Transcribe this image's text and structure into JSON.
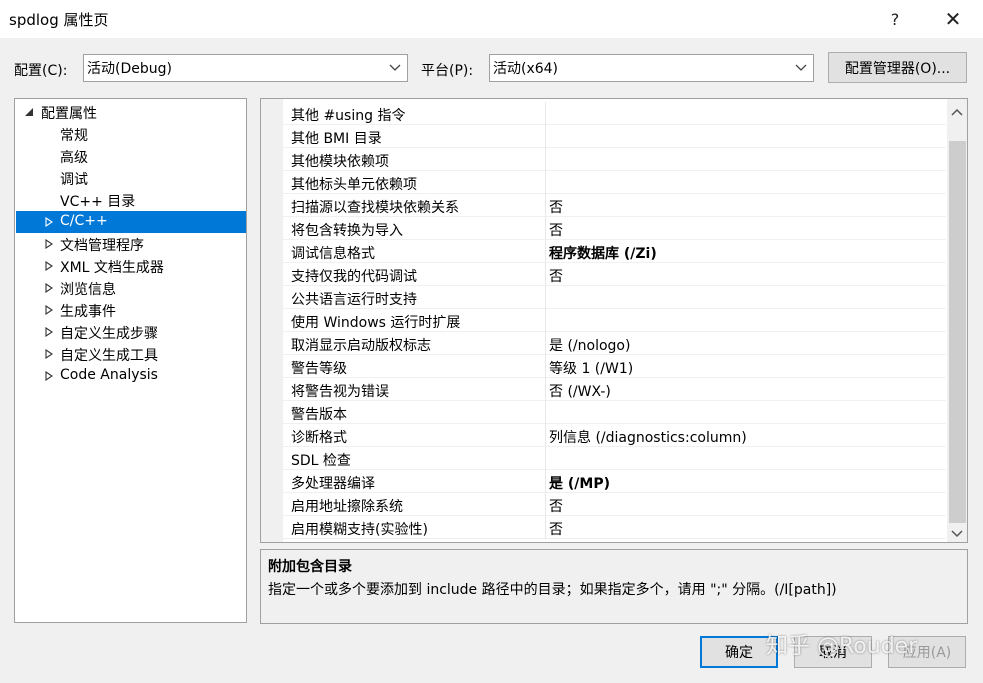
{
  "window": {
    "title": "spdlog 属性页",
    "help_label": "?",
    "close_label": "✕"
  },
  "config": {
    "config_label": "配置(C):",
    "config_value": "活动(Debug)",
    "platform_label": "平台(P):",
    "platform_value": "活动(x64)",
    "manager_button": "配置管理器(O)..."
  },
  "tree": {
    "root": "配置属性",
    "items": [
      "常规",
      "高级",
      "调试",
      "VC++ 目录",
      "C/C++",
      "文档管理程序",
      "XML 文档生成器",
      "浏览信息",
      "生成事件",
      "自定义生成步骤",
      "自定义生成工具",
      "Code Analysis"
    ],
    "selected": "C/C++"
  },
  "properties": [
    {
      "name": "其他 #using 指令",
      "value": ""
    },
    {
      "name": "其他 BMI 目录",
      "value": ""
    },
    {
      "name": "其他模块依赖项",
      "value": ""
    },
    {
      "name": "其他标头单元依赖项",
      "value": ""
    },
    {
      "name": "扫描源以查找模块依赖关系",
      "value": "否"
    },
    {
      "name": "将包含转换为导入",
      "value": "否"
    },
    {
      "name": "调试信息格式",
      "value": "程序数据库 (/Zi)",
      "bold": true
    },
    {
      "name": "支持仅我的代码调试",
      "value": "否"
    },
    {
      "name": "公共语言运行时支持",
      "value": ""
    },
    {
      "name": "使用 Windows 运行时扩展",
      "value": ""
    },
    {
      "name": "取消显示启动版权标志",
      "value": "是 (/nologo)"
    },
    {
      "name": "警告等级",
      "value": "等级 1 (/W1)"
    },
    {
      "name": "将警告视为错误",
      "value": "否 (/WX-)"
    },
    {
      "name": "警告版本",
      "value": ""
    },
    {
      "name": "诊断格式",
      "value": "列信息 (/diagnostics:column)"
    },
    {
      "name": "SDL 检查",
      "value": ""
    },
    {
      "name": "多处理器编译",
      "value": "是 (/MP)",
      "bold": true
    },
    {
      "name": "启用地址擦除系统",
      "value": "否"
    },
    {
      "name": "启用模糊支持(实验性)",
      "value": "否"
    }
  ],
  "description": {
    "title": "附加包含目录",
    "text": "指定一个或多个要添加到 include 路径中的目录；如果指定多个，请用 \";\" 分隔。(/I[path])"
  },
  "buttons": {
    "ok": "确定",
    "cancel": "取消",
    "apply": "应用(A)"
  },
  "watermark": "知乎 @Rouder",
  "colors": {
    "selection": "#0078d7",
    "background": "#f0f0f0"
  }
}
